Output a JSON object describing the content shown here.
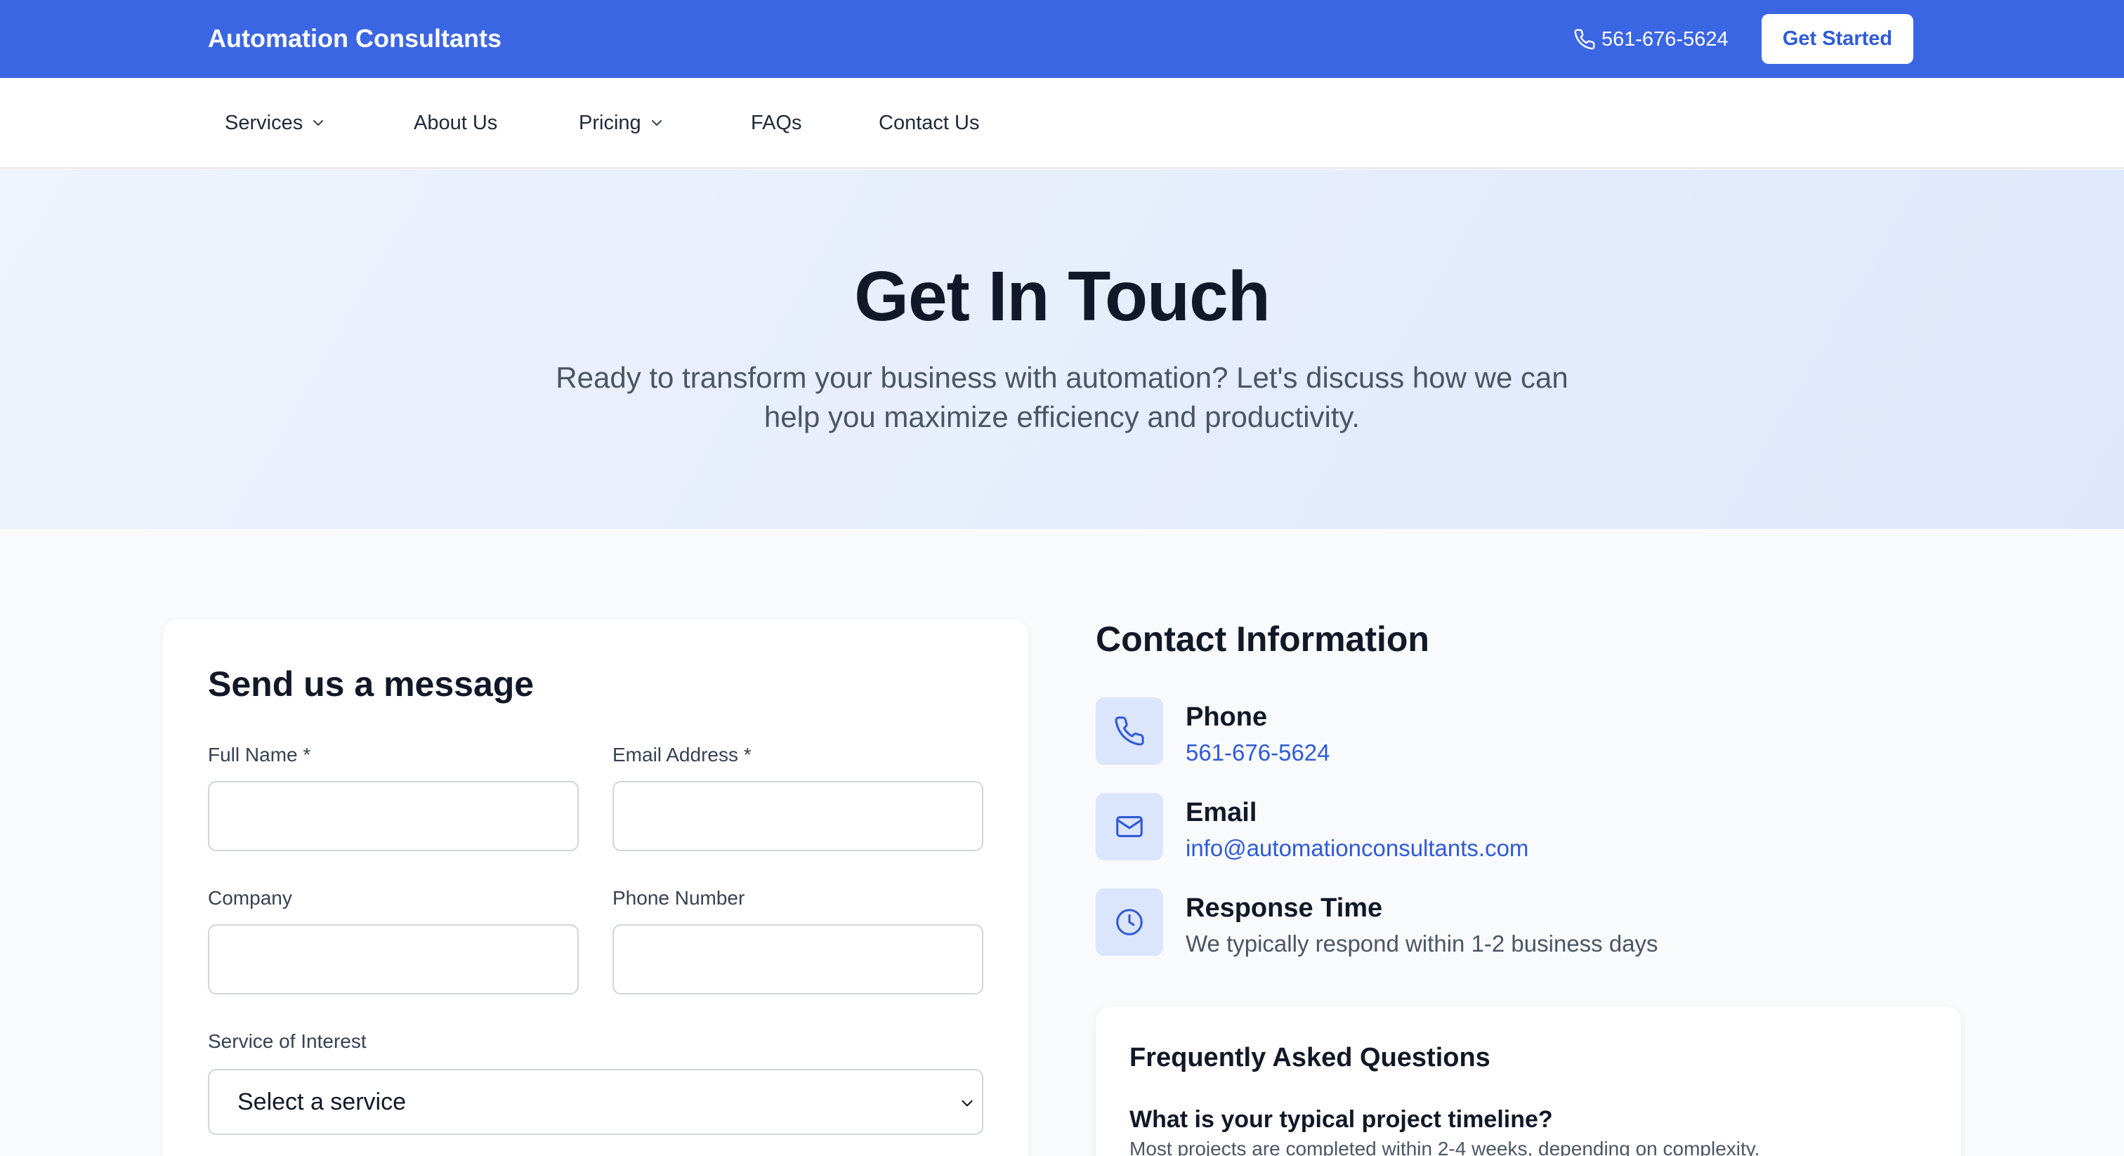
{
  "header": {
    "brand": "Automation Consultants",
    "phone": "561-676-5624",
    "phone_icon": "phone-icon",
    "cta_label": "Get Started",
    "accent_color": "#3b66e3"
  },
  "nav": {
    "items": [
      {
        "label": "Services",
        "has_dropdown": true
      },
      {
        "label": "About Us",
        "has_dropdown": false
      },
      {
        "label": "Pricing",
        "has_dropdown": true
      },
      {
        "label": "FAQs",
        "has_dropdown": false
      },
      {
        "label": "Contact Us",
        "has_dropdown": false
      }
    ]
  },
  "hero": {
    "title": "Get In Touch",
    "subtitle_line1": "Ready to transform your business with automation? Let's discuss how we can",
    "subtitle_line2": "help you maximize efficiency and productivity."
  },
  "form": {
    "title": "Send us a message",
    "full_name_label": "Full Name *",
    "full_name_value": "",
    "email_label": "Email Address *",
    "email_value": "",
    "company_label": "Company",
    "company_value": "",
    "phone_label": "Phone Number",
    "phone_value": "",
    "service_label": "Service of Interest",
    "service_selected": "Select a service"
  },
  "contact_info": {
    "title": "Contact Information",
    "phone": {
      "heading": "Phone",
      "value": "561-676-5624",
      "icon": "phone-icon"
    },
    "email": {
      "heading": "Email",
      "value": "info@automationconsultants.com",
      "icon": "mail-icon"
    },
    "response": {
      "heading": "Response Time",
      "value": "We typically respond within 1-2 business days",
      "icon": "clock-icon"
    }
  },
  "faq": {
    "title": "Frequently Asked Questions",
    "items": [
      {
        "question": "What is your typical project timeline?",
        "answer": "Most projects are completed within 2-4 weeks, depending on complexity."
      }
    ]
  }
}
